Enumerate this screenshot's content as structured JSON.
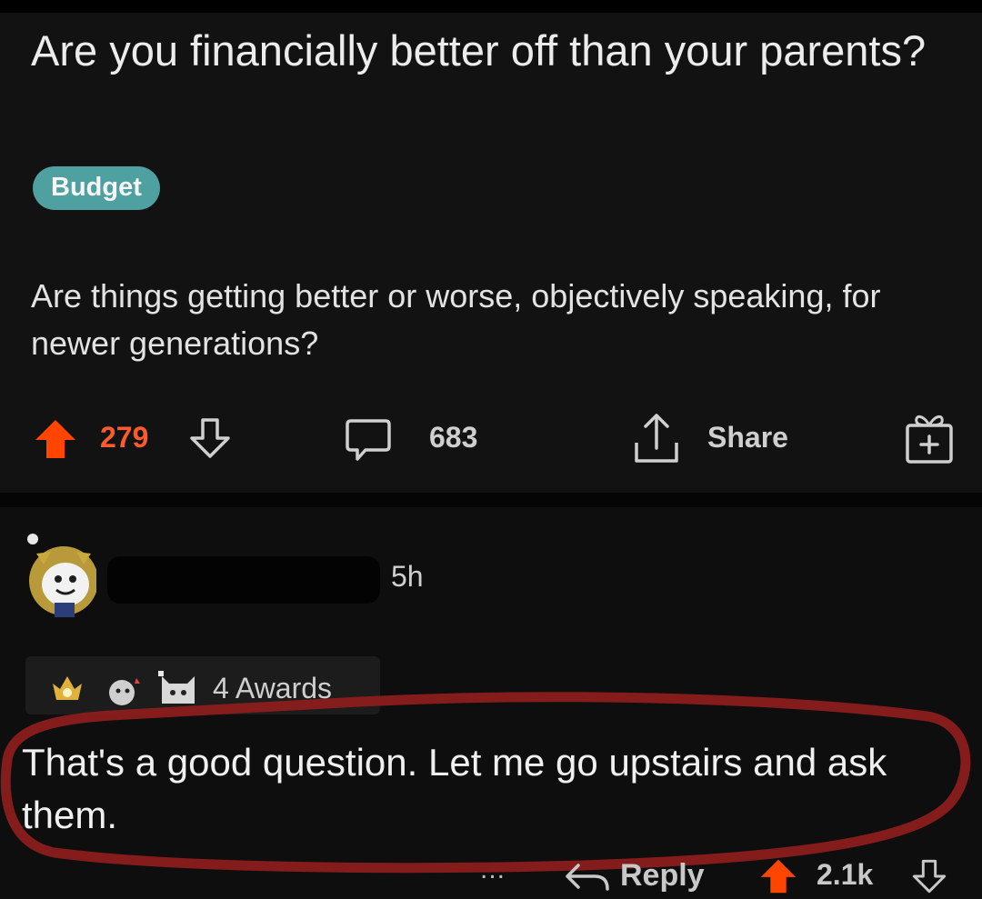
{
  "post": {
    "title": "Are you financially better off than your parents?",
    "flair": "Budget",
    "body": "Are things getting better or worse, objectively speaking, for newer generations?",
    "upvotes": "279",
    "comments": "683",
    "share_label": "Share"
  },
  "comment": {
    "time": "5h",
    "awards_label": "4 Awards",
    "text": "That's a good question. Let me go upstairs and ask them.",
    "more_label": "...",
    "reply_label": "Reply",
    "score": "2.1k"
  },
  "colors": {
    "upvote": "#ff4500",
    "flair": "#4fa0a0",
    "highlight_circle": "#8e1d1d"
  }
}
